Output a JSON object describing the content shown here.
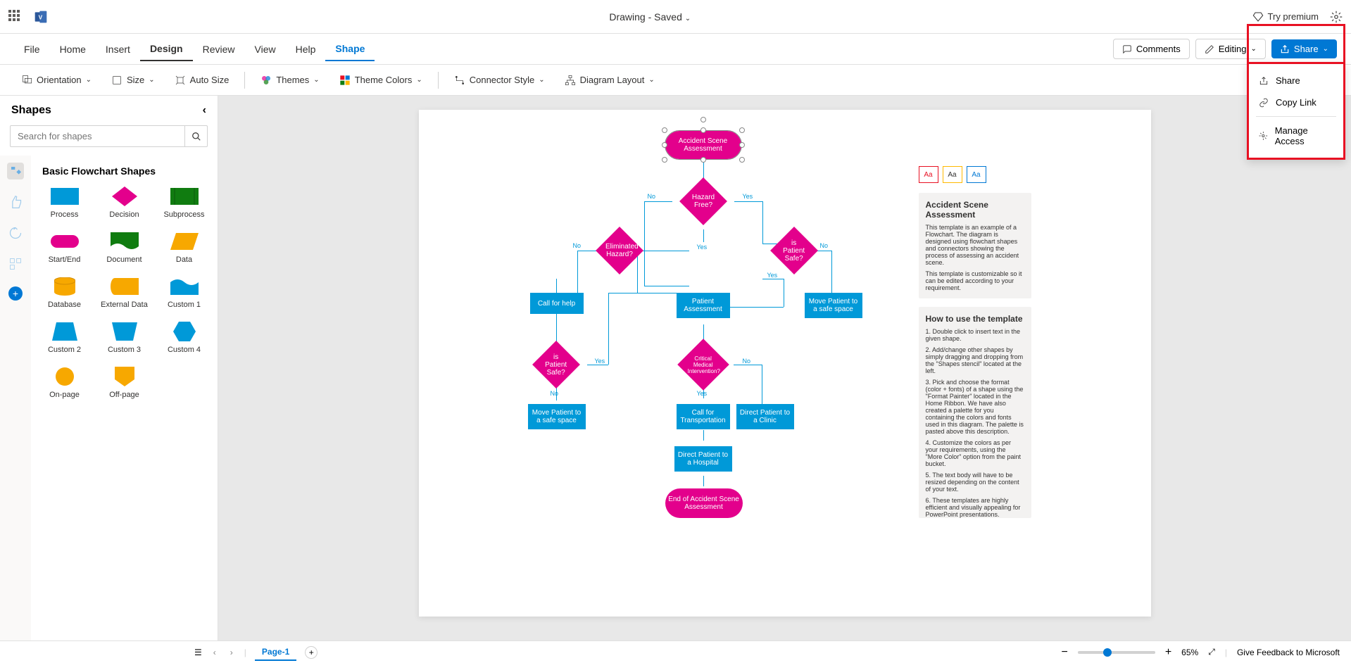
{
  "header": {
    "doc_title": "Drawing",
    "saved_label": "Saved",
    "premium_label": "Try premium"
  },
  "menubar": {
    "items": [
      "File",
      "Home",
      "Insert",
      "Design",
      "Review",
      "View",
      "Help",
      "Shape"
    ],
    "comments_label": "Comments",
    "editing_label": "Editing",
    "share_label": "Share"
  },
  "ribbon": {
    "orientation": "Orientation",
    "size": "Size",
    "autosize": "Auto Size",
    "themes": "Themes",
    "theme_colors": "Theme Colors",
    "connector_style": "Connector Style",
    "diagram_layout": "Diagram Layout"
  },
  "shapes_panel": {
    "title": "Shapes",
    "search_placeholder": "Search for shapes",
    "category": "Basic Flowchart Shapes",
    "items": [
      "Process",
      "Decision",
      "Subprocess",
      "Start/End",
      "Document",
      "Data",
      "Database",
      "External Data",
      "Custom 1",
      "Custom 2",
      "Custom 3",
      "Custom 4",
      "On-page",
      "Off-page"
    ]
  },
  "flowchart": {
    "start": "Accident Scene Assessment",
    "hazard_free": "Hazard Free?",
    "eliminated_hazard": "Eliminated Hazard?",
    "patient_safe_1": "is Patient Safe?",
    "call_for_help": "Call for help",
    "patient_assessment": "Patient Assessment",
    "move_patient_1": "Move Patient to a safe space",
    "patient_safe_2": "is Patient Safe?",
    "critical_medical": "Critical Medical Intervention?",
    "move_patient_2": "Move Patient to a safe space",
    "call_transport": "Call for Transportation",
    "direct_clinic": "Direct Patient to a Clinic",
    "direct_hospital": "Direct Patient to a Hospital",
    "end": "End of Accident Scene Assessment",
    "yes": "Yes",
    "no": "No"
  },
  "swatches": {
    "aa": "Aa"
  },
  "info1": {
    "title": "Accident Scene Assessment",
    "p1": "This template is an example of a Flowchart. The diagram is designed using flowchart shapes and connectors showing the process of assessing an accident scene.",
    "p2": "This template is customizable so it can be edited according to your requirement."
  },
  "info2": {
    "title": "How to use the template",
    "p1": "1. Double click to insert text in the given shape.",
    "p2": "2. Add/change other shapes by simply dragging and dropping from the \"Shapes stencil\" located at the left.",
    "p3": "3. Pick and choose the format (color + fonts) of a shape using the \"Format Painter\" located in the Home Ribbon. We have also created a palette for you containing the colors and fonts used in this diagram. The palette is pasted above this description.",
    "p4": "4. Customize the colors as per your requirements, using the \"More Color\" option from the paint bucket.",
    "p5": "5. The text body will have to be resized depending on the content of your text.",
    "p6": "6. These templates are highly efficient and visually appealing for PowerPoint presentations."
  },
  "share_menu": {
    "share": "Share",
    "copy_link": "Copy Link",
    "manage_access": "Manage Access"
  },
  "bottom": {
    "page_label": "Page-1",
    "zoom": "65%",
    "feedback": "Give Feedback to Microsoft"
  }
}
